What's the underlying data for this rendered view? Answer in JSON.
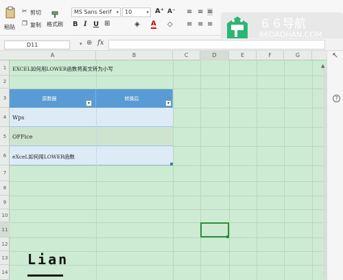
{
  "ribbon": {
    "paste_label": "粘贴",
    "cut_label": "剪切",
    "copy_label": "复制",
    "format_painter_label": "格式刷",
    "font_name": "MS Sans Serif",
    "font_size": "10"
  },
  "watermark": {
    "title": "６６导航",
    "url": "66DAOHAN.COM"
  },
  "formula_bar": {
    "cell_ref": "D11",
    "fx_label": "fx"
  },
  "columns": [
    "A",
    "B",
    "C",
    "D",
    "E",
    "F",
    "G"
  ],
  "rows": [
    "1",
    "2",
    "3",
    "4",
    "5",
    "6",
    "7",
    "8",
    "9",
    "10",
    "11",
    "12",
    "13",
    "14"
  ],
  "cells": {
    "a1": "EXCEL如何用LOWER函数将英文转为小写",
    "header_a": "原数据",
    "header_b": "转换后",
    "a4": "Wps",
    "a5": "OFFice",
    "a6": "eXceL如何用LOWER函数"
  },
  "logo_text": "Lian",
  "colors": {
    "sheet_bg": "#ccebd2",
    "table_header": "#5a9bd5",
    "table_row": "#ddebf7",
    "selection": "#2e8b3d"
  }
}
